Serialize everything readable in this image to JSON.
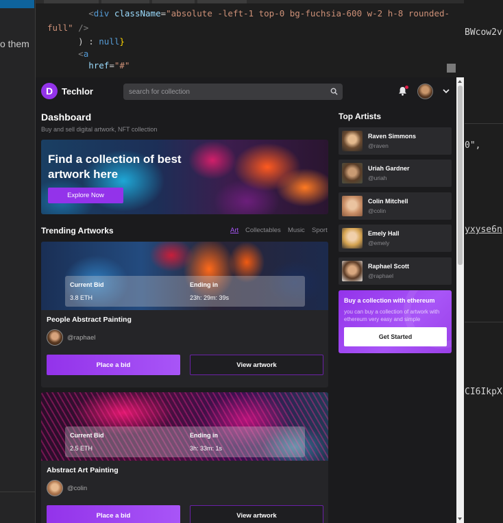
{
  "background_editor": {
    "left_text": "o them",
    "right_lines": [
      "BWcow2v",
      "0\",",
      "yxyse6n",
      "CI6IkpX"
    ]
  },
  "code": {
    "lines": [
      {
        "indent": "        ",
        "tokens": [
          [
            "tag",
            "<"
          ],
          [
            "el",
            "div"
          ],
          [
            "plain",
            " "
          ],
          [
            "attr",
            "className"
          ],
          [
            "plain",
            "="
          ],
          [
            "str",
            "\"absolute -left-1 top-0 bg-fuchsia-600 w-2 h-8 rounded-"
          ]
        ]
      },
      {
        "indent": "",
        "tokens": [
          [
            "str",
            "full\""
          ],
          [
            "plain",
            " "
          ],
          [
            "tag",
            "/>"
          ]
        ]
      },
      {
        "indent": "      ",
        "tokens": [
          [
            "plain",
            ") : "
          ],
          [
            "kw",
            "null"
          ],
          [
            "punc",
            "}"
          ]
        ]
      },
      {
        "indent": "      ",
        "tokens": [
          [
            "tag",
            "<"
          ],
          [
            "el",
            "a"
          ]
        ]
      },
      {
        "indent": "        ",
        "tokens": [
          [
            "attr",
            "href"
          ],
          [
            "plain",
            "="
          ],
          [
            "str",
            "\"#\""
          ]
        ]
      }
    ]
  },
  "app": {
    "logo_letter": "D",
    "logo_name": "Techlor",
    "search_placeholder": "search for collection",
    "colors": {
      "accent": "#9333ea",
      "bg": "#1b1b1d",
      "card": "#252528",
      "artist_card": "#2a2a2d"
    }
  },
  "dashboard": {
    "title": "Dashboard",
    "subtitle": "Buy and sell digital artwork, NFT collection",
    "banner_title": "Find a collection of best artwork here",
    "explore_label": "Explore Now"
  },
  "trending": {
    "title": "Trending Artworks",
    "tabs": [
      "Art",
      "Collectables",
      "Music",
      "Sport"
    ],
    "active_tab": "Art",
    "cards": [
      {
        "bid_label": "Current Bid",
        "bid_value": "3.8 ETH",
        "ending_label": "Ending in",
        "ending_value": "23h: 29m: 39s",
        "title": "People Abstract Painting",
        "owner": "@raphael",
        "bid_button": "Place a bid",
        "view_button": "View artwork"
      },
      {
        "bid_label": "Current Bid",
        "bid_value": "2.5 ETH",
        "ending_label": "Ending in",
        "ending_value": "3h: 33m: 1s",
        "title": "Abstract Art Painting",
        "owner": "@colin",
        "bid_button": "Place a bid",
        "view_button": "View artwork"
      }
    ]
  },
  "artists": {
    "title": "Top Artists",
    "items": [
      {
        "name": "Raven Simmons",
        "handle": "@raven"
      },
      {
        "name": "Uriah Gardner",
        "handle": "@uriah"
      },
      {
        "name": "Colin Mitchell",
        "handle": "@colin"
      },
      {
        "name": "Emely Hall",
        "handle": "@emely"
      },
      {
        "name": "Raphael Scott",
        "handle": "@raphael"
      }
    ]
  },
  "promo": {
    "title": "Buy a collection with ethereum",
    "description": "you can buy a collection of artwork with ethereum very easy and simple",
    "button": "Get Started"
  }
}
